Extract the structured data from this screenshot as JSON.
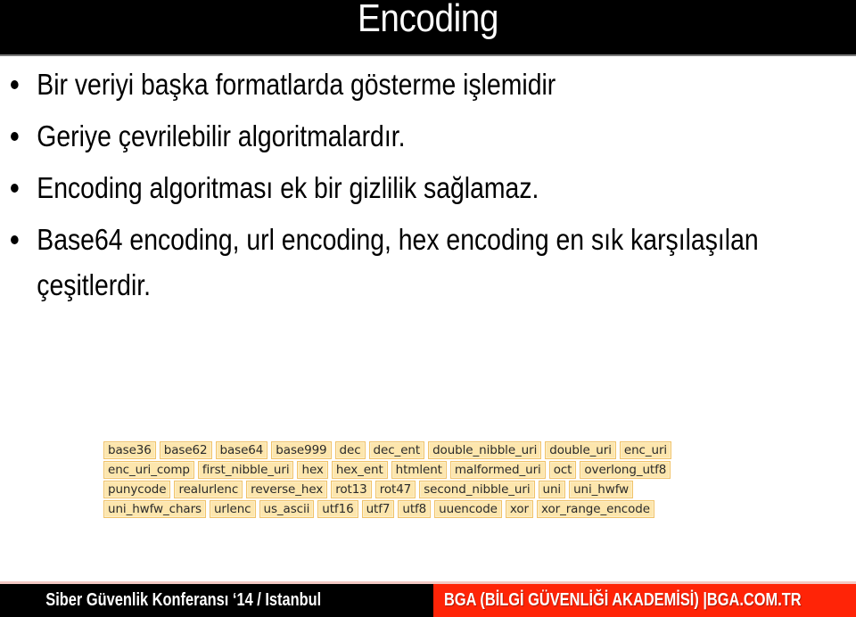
{
  "slide": {
    "title": "Encoding",
    "bullets": [
      "Bir veriyi başka formatlarda gösterme işlemidir",
      "Geriye çevrilebilir algoritmalardır.",
      "Encoding algoritması  ek bir gizlilik sağlamaz.",
      "Base64 encoding, url encoding, hex encoding en sık karşılaşılan çeşitlerdir."
    ],
    "encoding_tags": [
      [
        "base36",
        "base62",
        "base64",
        "base999",
        "dec",
        "dec_ent",
        "double_nibble_uri",
        "double_uri",
        "enc_uri"
      ],
      [
        "enc_uri_comp",
        "first_nibble_uri",
        "hex",
        "hex_ent",
        "htmlent",
        "malformed_uri",
        "oct",
        "overlong_utf8"
      ],
      [
        "punycode",
        "realurlenc",
        "reverse_hex",
        "rot13",
        "rot47",
        "second_nibble_uri",
        "uni",
        "uni_hwfw"
      ],
      [
        "uni_hwfw_chars",
        "urlenc",
        "us_ascii",
        "utf16",
        "utf7",
        "utf8",
        "uuencode",
        "xor",
        "xor_range_encode"
      ]
    ]
  },
  "footer": {
    "left_text": "Siber Güvenlik Konferansı ‘14 / Istanbul",
    "right_text": "BGA (BİLGİ GÜVENLİĞİ AKADEMİSİ) |BGA.COM.TR"
  },
  "colors": {
    "header_bg": "#000000",
    "footer_accent": "#ff2407",
    "tag_bg": "#fde6ad",
    "tag_border": "#f1c36a"
  }
}
